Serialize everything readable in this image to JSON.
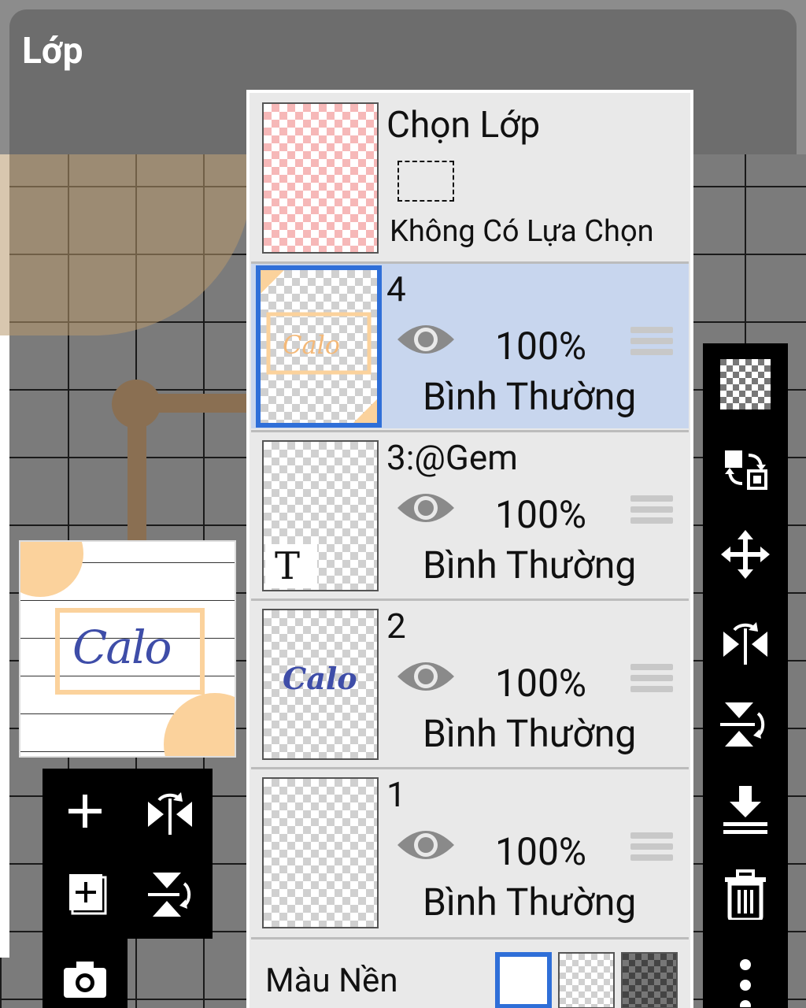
{
  "header": {
    "title": "Lớp"
  },
  "selection_layer": {
    "title": "Chọn Lớp",
    "subtitle": "Không Có Lựa Chọn"
  },
  "layers": [
    {
      "name": "4",
      "opacity": "100%",
      "blend": "Bình Thường",
      "visible": true,
      "active": true
    },
    {
      "name": "3:@Gem",
      "opacity": "100%",
      "blend": "Bình Thường",
      "visible": true,
      "active": false,
      "thumb_text": "T"
    },
    {
      "name": "2",
      "opacity": "100%",
      "blend": "Bình Thường",
      "visible": true,
      "active": false,
      "thumb_text": "Calo"
    },
    {
      "name": "1",
      "opacity": "100%",
      "blend": "Bình Thường",
      "visible": true,
      "active": false
    }
  ],
  "background": {
    "label": "Màu Nền",
    "options": [
      "white",
      "transparent",
      "dark-checker"
    ],
    "selected": "white"
  },
  "preview": {
    "text": "Calo"
  },
  "left_tools": [
    "add-layer-icon",
    "flip-horizontal-icon",
    "add-layer-copy-icon",
    "flip-vertical-icon",
    "camera-icon"
  ],
  "right_tools": [
    "transparency-icon",
    "swap-layer-icon",
    "move-icon",
    "flip-horizontal-icon",
    "flip-vertical-icon",
    "merge-down-icon",
    "delete-icon",
    "more-icon"
  ],
  "colors": {
    "accent": "#2f6fd8",
    "active_row": "#c8d6ee",
    "panel": "#e9e9e9",
    "peach": "#fbd29c",
    "calo_blue": "#3e4da8"
  }
}
